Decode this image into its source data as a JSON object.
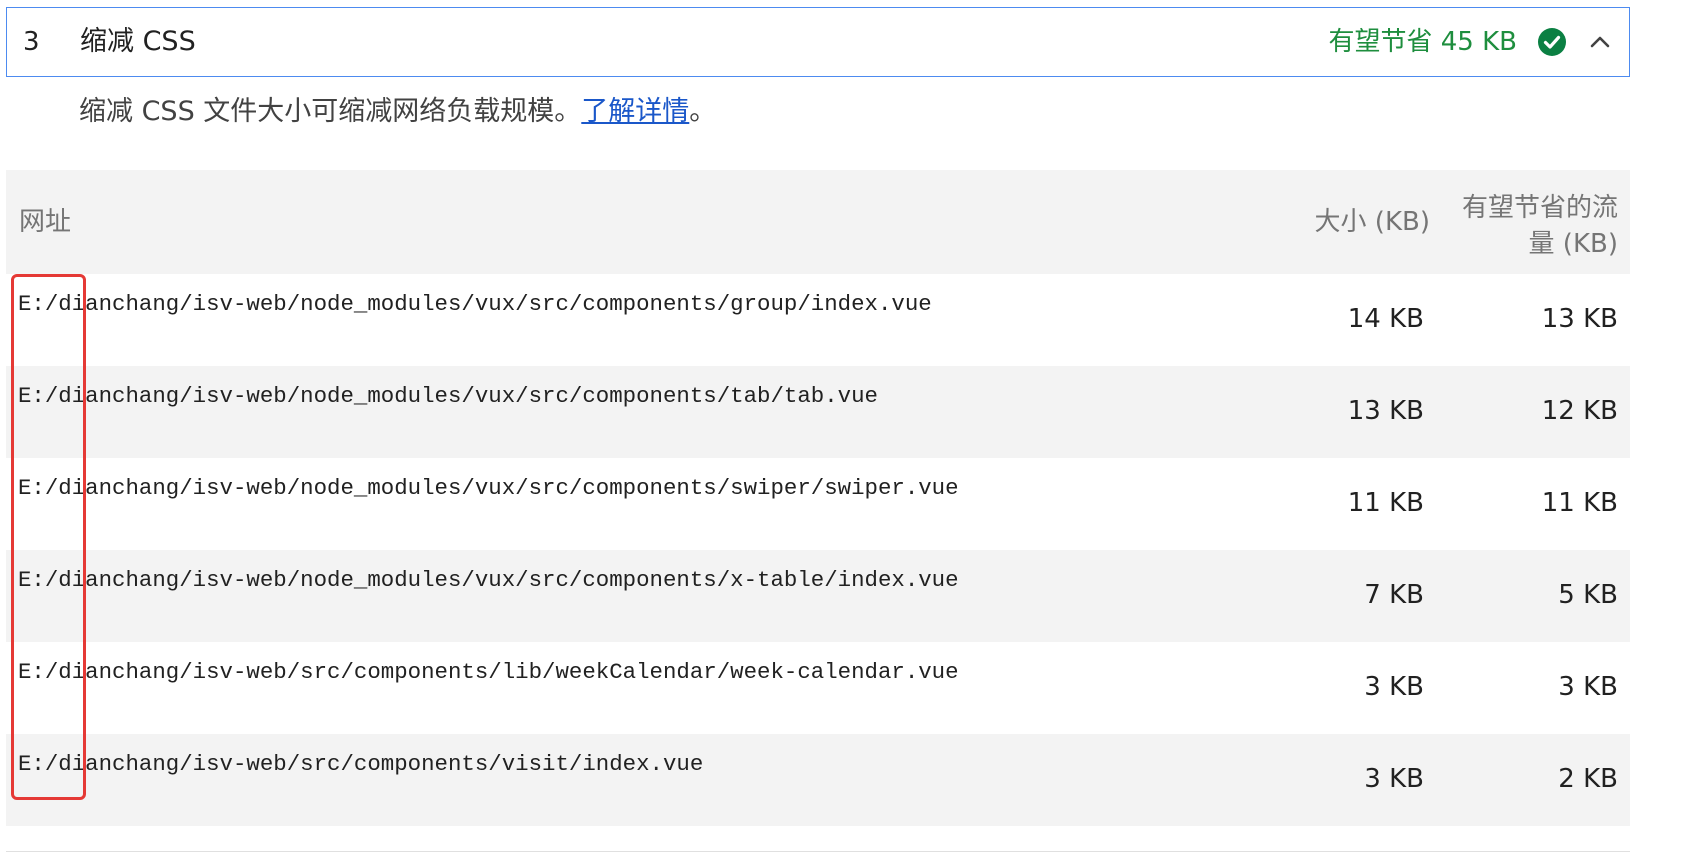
{
  "audit": {
    "index": "3",
    "title": "缩减 CSS",
    "savings": "有望节省 45 KB",
    "pass_icon": "check-circle-icon",
    "chevron_icon": "chevron-up-icon",
    "description_prefix": "缩减 CSS 文件大小可缩减网络负载规模。",
    "description_link": "了解详情",
    "description_suffix": "。"
  },
  "table": {
    "headers": {
      "url": "网址",
      "size": "大小 (KB)",
      "savings": "有望节省的流量 (KB)"
    },
    "rows": [
      {
        "url": "E:/dianchang/isv-web/node_modules/vux/src/components/group/index.vue",
        "size": "14 KB",
        "savings": "13 KB"
      },
      {
        "url": "E:/dianchang/isv-web/node_modules/vux/src/components/tab/tab.vue",
        "size": "13 KB",
        "savings": "12 KB"
      },
      {
        "url": "E:/dianchang/isv-web/node_modules/vux/src/components/swiper/swiper.vue",
        "size": "11 KB",
        "savings": "11 KB"
      },
      {
        "url": "E:/dianchang/isv-web/node_modules/vux/src/components/x-table/index.vue",
        "size": "7 KB",
        "savings": "5 KB"
      },
      {
        "url": "E:/dianchang/isv-web/src/components/lib/weekCalendar/week-calendar.vue",
        "size": "3 KB",
        "savings": "3 KB"
      },
      {
        "url": "E:/dianchang/isv-web/src/components/visit/index.vue",
        "size": "3 KB",
        "savings": "2 KB"
      }
    ]
  },
  "colors": {
    "accent_border": "#4d8bf0",
    "savings_green": "#1e8e3e",
    "link_blue": "#1a57c9",
    "annotation_red": "#e53935"
  }
}
